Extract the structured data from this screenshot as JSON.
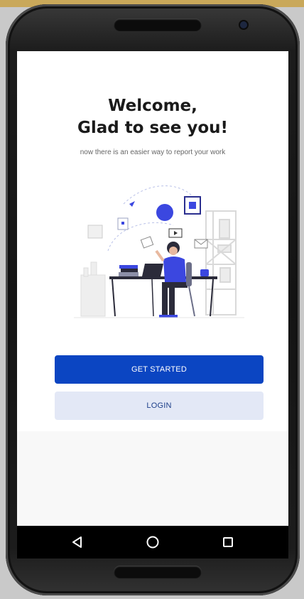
{
  "welcome": {
    "title_line1": "Welcome,",
    "title_line2": "Glad to see you!",
    "subtitle": "now there is an easier way to report your work"
  },
  "actions": {
    "get_started_label": "GET STARTED",
    "login_label": "LOGIN"
  },
  "navigation": {
    "back_icon": "back-triangle-icon",
    "home_icon": "home-circle-icon",
    "recents_icon": "recents-square-icon"
  },
  "colors": {
    "primary": "#0b45c2",
    "secondary_bg": "#e3e8f6",
    "illustration_accent": "#3b47e0"
  }
}
